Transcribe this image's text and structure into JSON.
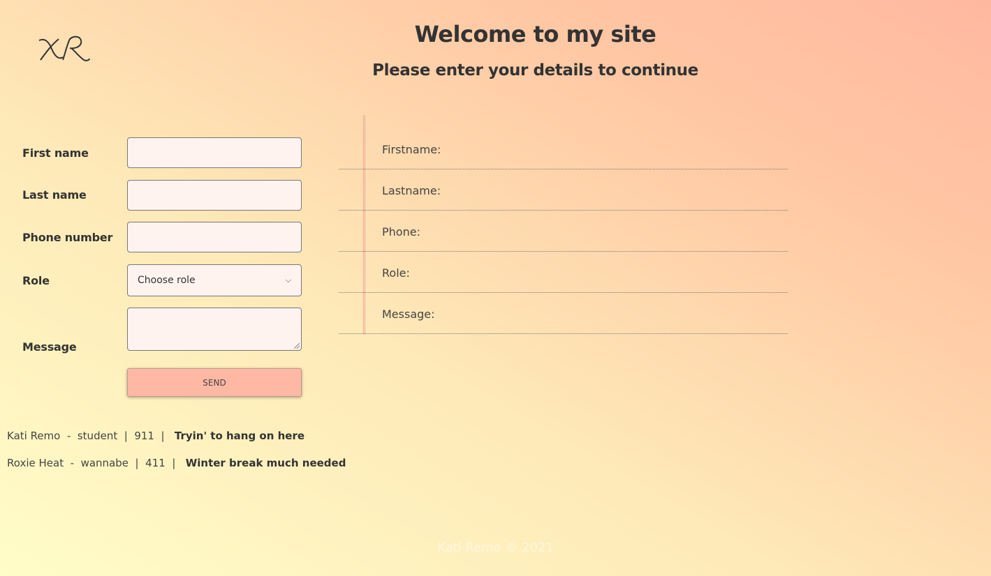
{
  "header": {
    "title": "Welcome to my site",
    "subtitle": "Please enter your details to continue"
  },
  "logo": {
    "icon": "kr-monogram-logo",
    "text": "KR"
  },
  "form": {
    "first_name_label": "First name",
    "last_name_label": "Last name",
    "phone_label": "Phone number",
    "role_label": "Role",
    "message_label": "Message",
    "first_name_value": "",
    "last_name_value": "",
    "phone_value": "",
    "role_selected": "Choose role",
    "message_value": "",
    "send_label": "SEND"
  },
  "preview": {
    "labels": [
      "Firstname:",
      "Lastname:",
      "Phone:",
      "Role:",
      "Message:"
    ]
  },
  "entries": [
    {
      "name": "Kati Remo",
      "role": "student",
      "phone": "911",
      "message": "Tryin' to hang on here"
    },
    {
      "name": "Roxie Heat",
      "role": "wannabe",
      "phone": "411",
      "message": "Winter break much needed"
    }
  ],
  "footer": {
    "text": "Kati Remo © 2021"
  },
  "colors": {
    "button": "#ffb8a4",
    "input_bg": "#fff3ef",
    "margin_line": "#f2a89a",
    "text": "#333333"
  }
}
